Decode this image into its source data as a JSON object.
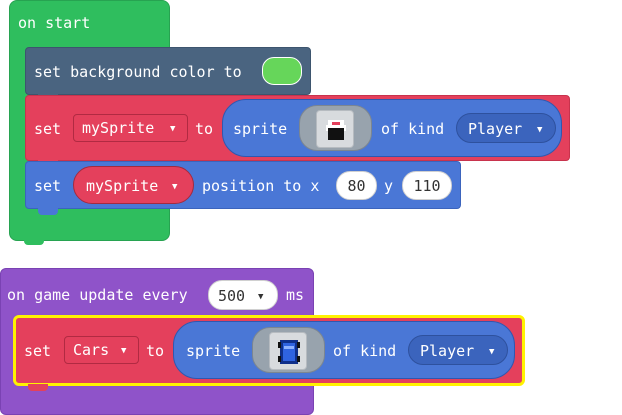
{
  "colors": {
    "event_green": "#2fbe5e",
    "event_purple": "#8f53c9",
    "scene_slate": "#4a6480",
    "sprite_red": "#e4405c",
    "sprite_blue": "#4a77d6",
    "selection_yellow": "#fff200",
    "background_color_value": "#66d65a"
  },
  "on_start": {
    "label": "on start",
    "set_background": {
      "label": "set background color to",
      "color": "#66d65a"
    },
    "set_sprite": {
      "set_label": "set",
      "variable": "mySprite",
      "to_label": "to",
      "sprite_label": "sprite",
      "image": "player-sprite-icon",
      "of_kind_label": "of kind",
      "kind": "Player"
    },
    "set_position": {
      "set_label": "set",
      "variable": "mySprite",
      "position_label": "position to x",
      "x": "80",
      "y_label": "y",
      "y": "110"
    }
  },
  "on_game_update": {
    "label": "on game update every",
    "interval": "500",
    "unit": "ms",
    "set_sprite": {
      "set_label": "set",
      "variable": "Cars",
      "to_label": "to",
      "sprite_label": "sprite",
      "image": "car-sprite-icon",
      "of_kind_label": "of kind",
      "kind": "Player"
    }
  },
  "icons": {
    "dropdown": "caret-down-icon"
  }
}
